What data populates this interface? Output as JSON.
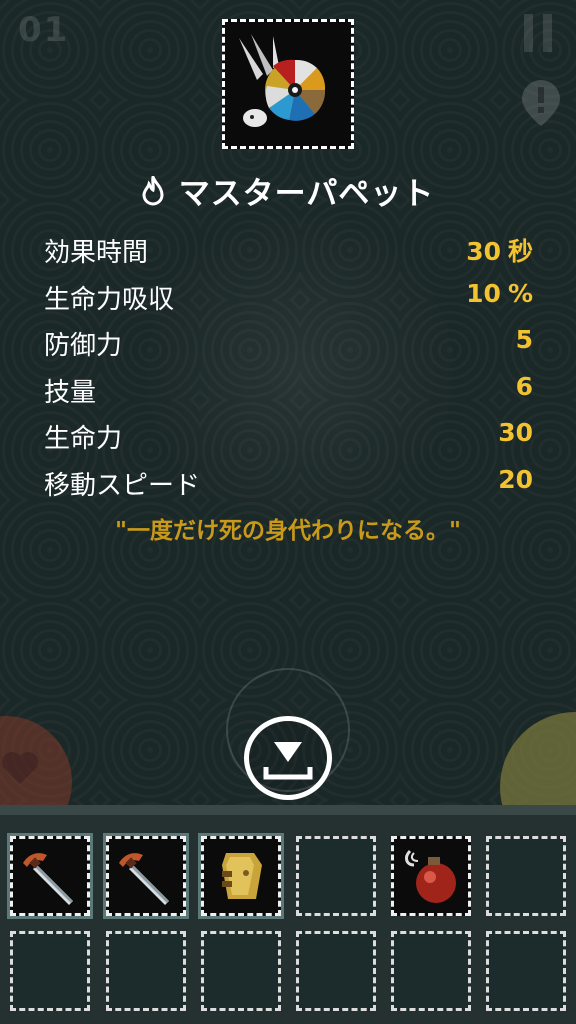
{
  "hud": {
    "level_number": "01"
  },
  "item": {
    "name": "マスターパペット",
    "icon": "master-puppet-icon",
    "quote": "\"一度だけ死の身代わりになる。\""
  },
  "stats": [
    {
      "label": "効果時間",
      "value": "30",
      "unit": "秒"
    },
    {
      "label": "生命力吸収",
      "value": "10",
      "unit": "%"
    },
    {
      "label": "防御力",
      "value": "5",
      "unit": ""
    },
    {
      "label": "技量",
      "value": "6",
      "unit": ""
    },
    {
      "label": "生命力",
      "value": "30",
      "unit": ""
    },
    {
      "label": "移動スピード",
      "value": "20",
      "unit": ""
    }
  ],
  "colors": {
    "accent_value": "#f2c230",
    "quote": "#c99a1a",
    "background": "#223131"
  },
  "inventory": {
    "slots": [
      {
        "icon": "dagger-icon"
      },
      {
        "icon": "dagger-icon"
      },
      {
        "icon": "gold-armor-icon"
      },
      {
        "icon": ""
      },
      {
        "icon": "red-potion-icon"
      },
      {
        "icon": ""
      },
      {
        "icon": ""
      },
      {
        "icon": ""
      },
      {
        "icon": ""
      },
      {
        "icon": ""
      },
      {
        "icon": ""
      },
      {
        "icon": ""
      }
    ]
  }
}
